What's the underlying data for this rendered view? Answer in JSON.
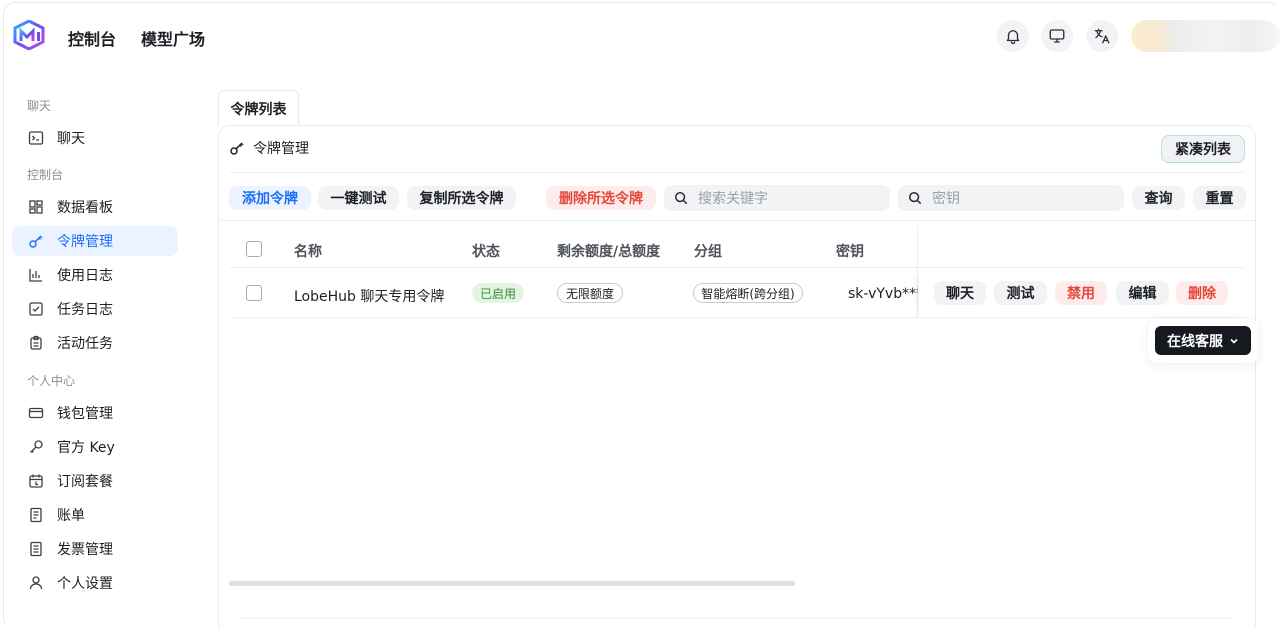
{
  "header": {
    "nav": [
      "控制台",
      "模型广场"
    ]
  },
  "sidebar": {
    "sections": [
      "聊天",
      "控制台",
      "个人中心"
    ],
    "items": [
      {
        "label": "聊天",
        "icon": "terminal-icon"
      },
      {
        "label": "数据看板",
        "icon": "dashboard-icon"
      },
      {
        "label": "令牌管理",
        "icon": "key-icon",
        "active": true
      },
      {
        "label": "使用日志",
        "icon": "bar-chart-icon"
      },
      {
        "label": "任务日志",
        "icon": "checkbox-icon"
      },
      {
        "label": "活动任务",
        "icon": "clipboard-icon"
      },
      {
        "label": "钱包管理",
        "icon": "wallet-icon"
      },
      {
        "label": "官方 Key",
        "icon": "key-alt-icon"
      },
      {
        "label": "订阅套餐",
        "icon": "calendar-icon"
      },
      {
        "label": "账单",
        "icon": "bill-icon"
      },
      {
        "label": "发票管理",
        "icon": "invoice-icon"
      },
      {
        "label": "个人设置",
        "icon": "user-icon"
      }
    ]
  },
  "main": {
    "tab": "令牌列表",
    "card_title": "令牌管理",
    "compact_button": "紧凑列表",
    "toolbar": {
      "add": "添加令牌",
      "test_all": "一键测试",
      "copy_selected": "复制所选令牌",
      "delete_selected": "删除所选令牌",
      "search_placeholder": "搜索关键字",
      "key_placeholder": "密钥",
      "query": "查询",
      "reset": "重置"
    },
    "table": {
      "columns": [
        "名称",
        "状态",
        "剩余额度/总额度",
        "分组",
        "密钥"
      ],
      "rows": [
        {
          "name": "LobeHub 聊天专用令牌",
          "status": "已启用",
          "quota": "无限额度",
          "group": "智能熔断(跨分组)",
          "key": "sk-vYvb****",
          "actions": [
            "聊天",
            "测试",
            "禁用",
            "编辑",
            "删除"
          ]
        }
      ]
    }
  },
  "support": {
    "label": "在线客服"
  },
  "colors": {
    "accent": "#1d6ef7",
    "danger": "#e5483a",
    "success": "#3a8c3a"
  }
}
